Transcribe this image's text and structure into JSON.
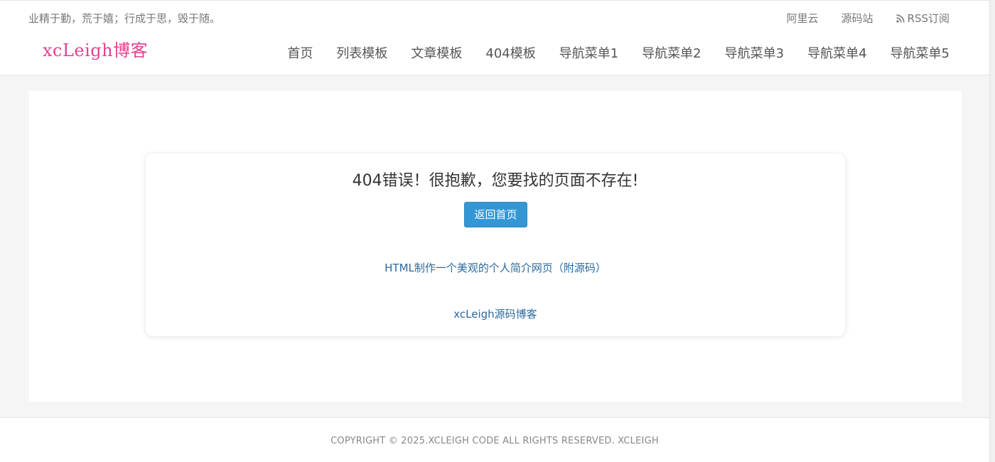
{
  "header": {
    "motto": "业精于勤，荒于嬉；行成于思，毁于随。",
    "top_links": [
      {
        "label": "阿里云"
      },
      {
        "label": "源码站"
      },
      {
        "label": "RSS订阅",
        "icon": "rss-icon"
      }
    ],
    "logo": "xcLeigh博客",
    "nav": [
      {
        "label": "首页"
      },
      {
        "label": "列表模板"
      },
      {
        "label": "文章模板"
      },
      {
        "label": "404模板"
      },
      {
        "label": "导航菜单1"
      },
      {
        "label": "导航菜单2"
      },
      {
        "label": "导航菜单3"
      },
      {
        "label": "导航菜单4"
      },
      {
        "label": "导航菜单5"
      }
    ]
  },
  "error_card": {
    "title": "404错误！很抱歉，您要找的页面不存在!",
    "home_button": "返回首页",
    "link1": "HTML制作一个美观的个人简介网页（附源码）",
    "link2": "xcLeigh源码博客"
  },
  "footer": {
    "copyright": "COPYRIGHT © 2025.XCLEIGH CODE ALL RIGHTS RESERVED. XCLEIGH"
  },
  "colors": {
    "logo": "#e8408f",
    "button": "#3497d4",
    "link": "#2a6aa0",
    "background": "#f5f5f5"
  }
}
